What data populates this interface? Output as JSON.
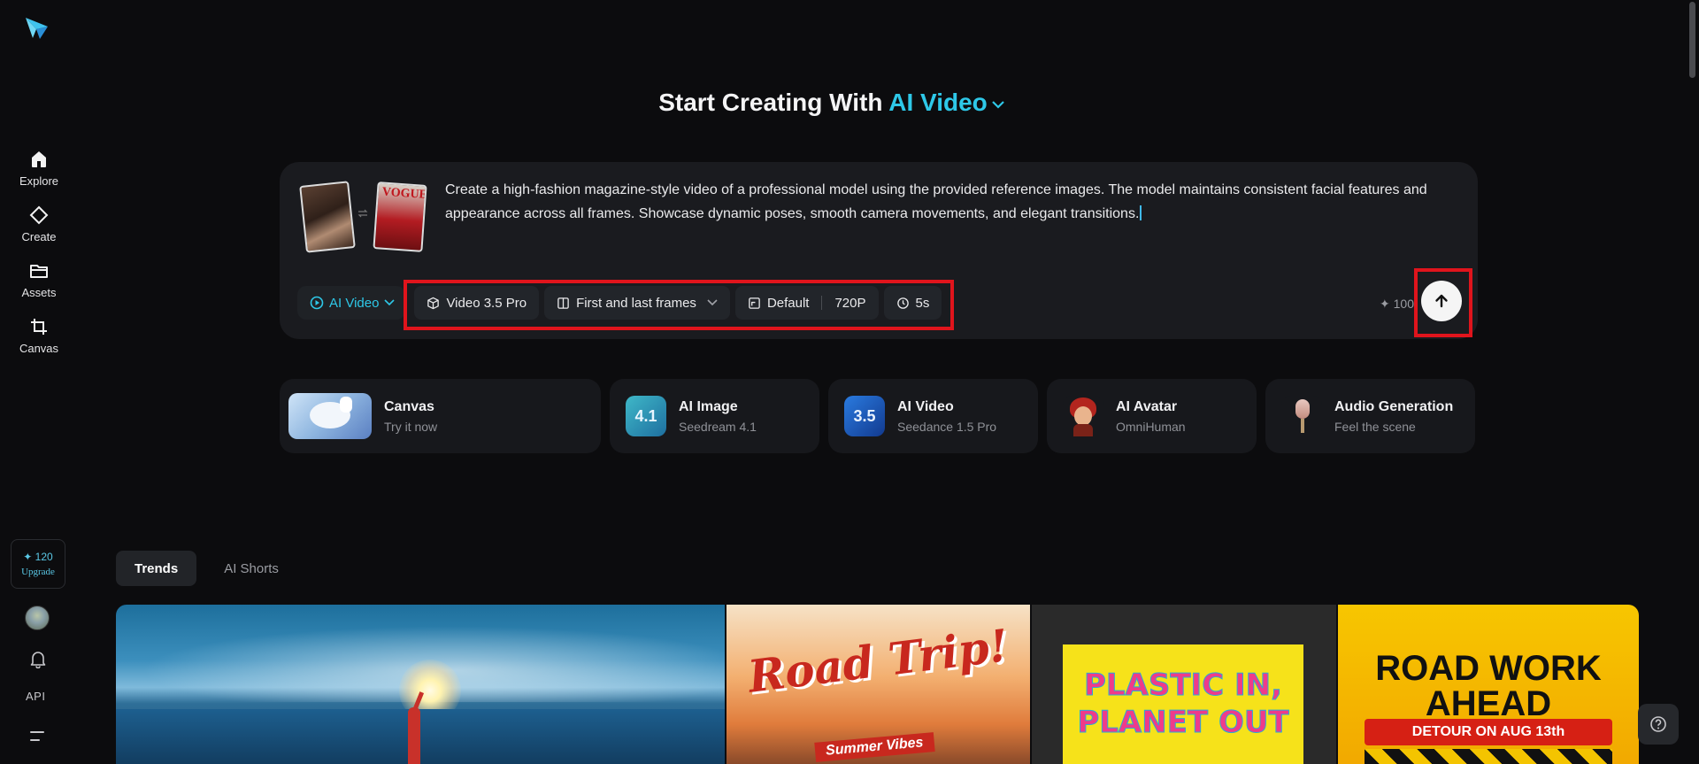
{
  "sidebar": {
    "logo": "paper-plane-logo",
    "items": [
      {
        "label": "Explore",
        "icon": "home-icon"
      },
      {
        "label": "Create",
        "icon": "diamond-icon"
      },
      {
        "label": "Assets",
        "icon": "folder-icon"
      },
      {
        "label": "Canvas",
        "icon": "crop-icon"
      }
    ],
    "credits": {
      "amount": "120",
      "upgrade": "Upgrade"
    },
    "api_label": "API"
  },
  "header": {
    "title_prefix": "Start Creating With",
    "mode": "AI Video"
  },
  "prompt": {
    "text": "Create a high-fashion magazine-style video of a professional model using the provided reference images. The model maintains consistent facial features and appearance across all frames. Showcase dynamic poses, smooth camera movements, and elegant transitions.",
    "magazine_mark": "VOGUE"
  },
  "toolbar": {
    "mode_label": "AI Video",
    "model": "Video 3.5 Pro",
    "frames": "First and last frames",
    "ratio": "Default",
    "resolution": "720P",
    "duration": "5s",
    "cost": "100"
  },
  "features": [
    {
      "title": "Canvas",
      "subtitle": "Try it now",
      "badge": ""
    },
    {
      "title": "AI Image",
      "subtitle": "Seedream 4.1",
      "badge": "4.1"
    },
    {
      "title": "AI Video",
      "subtitle": "Seedance 1.5 Pro",
      "badge": "3.5"
    },
    {
      "title": "AI Avatar",
      "subtitle": "OmniHuman",
      "badge": ""
    },
    {
      "title": "Audio Generation",
      "subtitle": "Feel the scene",
      "badge": ""
    }
  ],
  "tabs": [
    {
      "label": "Trends",
      "active": true
    },
    {
      "label": "AI Shorts",
      "active": false
    }
  ],
  "gallery": {
    "road_trip_title": "Road Trip!",
    "road_trip_sub": "Summer Vibes",
    "plastic_title": "PLASTIC IN, PLANET OUT",
    "roadwork_title": "ROAD WORK AHEAD",
    "roadwork_sub": "DETOUR ON AUG 13th"
  },
  "colors": {
    "accent": "#2ec8e8",
    "highlight": "#e0141c",
    "background": "#0c0c0e",
    "card": "#1a1b1f"
  }
}
